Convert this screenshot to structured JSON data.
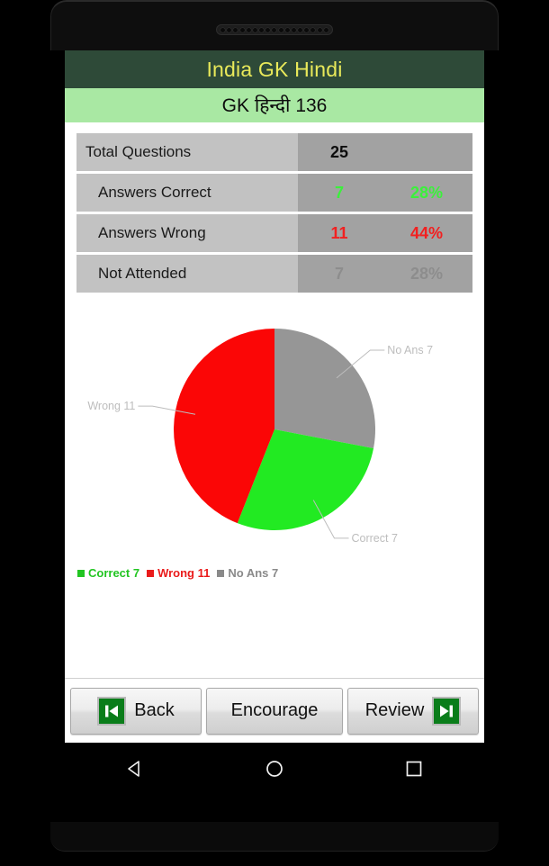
{
  "device": {
    "speaker_holes": 17
  },
  "header": {
    "title": "India GK Hindi",
    "subtitle": "GK हिन्दी 136",
    "title_color": "#e9e95a",
    "title_bg": "#2e4a38",
    "subtitle_bg": "#a9e8a3"
  },
  "stats": {
    "rows": [
      {
        "label": "Total Questions",
        "value": "25",
        "percent": "",
        "tone": "dark",
        "indent": false
      },
      {
        "label": "Answers Correct",
        "value": "7",
        "percent": "28%",
        "tone": "green",
        "indent": true
      },
      {
        "label": "Answers Wrong",
        "value": "11",
        "percent": "44%",
        "tone": "red",
        "indent": true
      },
      {
        "label": "Not Attended",
        "value": "7",
        "percent": "28%",
        "tone": "gray",
        "indent": true
      }
    ]
  },
  "chart_data": {
    "type": "pie",
    "title": "",
    "categories": [
      "No Ans",
      "Correct",
      "Wrong"
    ],
    "values": [
      7,
      7,
      11
    ],
    "total": 25,
    "colors": [
      "#969696",
      "#22ea22",
      "#fb0606"
    ],
    "labels": [
      "No Ans 7",
      "Correct 7",
      "Wrong 11"
    ],
    "label_color": "#bdbdbd",
    "start_angle_deg": 0,
    "direction": "clockwise",
    "legend_position": "bottom-left",
    "grid": false
  },
  "legend": {
    "items": [
      {
        "text": "Correct 7",
        "color": "#22c522"
      },
      {
        "text": "Wrong 11",
        "color": "#ea1b1b"
      },
      {
        "text": "No Ans 7",
        "color": "#8a8a8a"
      }
    ]
  },
  "buttons": {
    "back": "Back",
    "encourage": "Encourage",
    "review": "Review"
  },
  "navbar": {
    "back": "back-triangle",
    "home": "home-circle",
    "recents": "recents-square"
  }
}
